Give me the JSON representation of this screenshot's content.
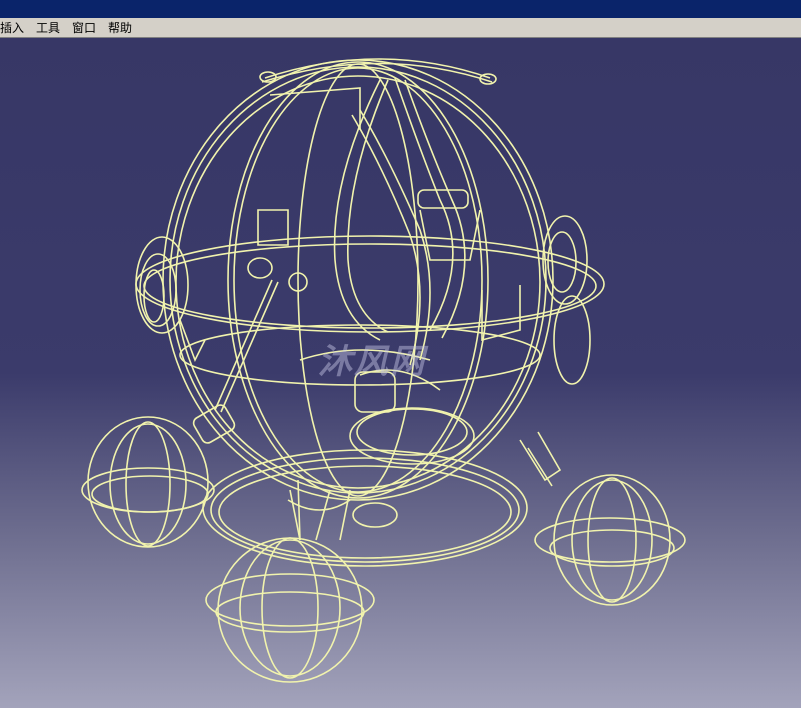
{
  "window": {
    "title_bar_color": "#0a246a"
  },
  "menu": {
    "items": [
      {
        "label": "插入"
      },
      {
        "label": "工具"
      },
      {
        "label": "窗口"
      },
      {
        "label": "帮助"
      }
    ]
  },
  "viewport": {
    "background_top": "#373766",
    "background_bottom": "#a3a3bb",
    "wire_color": "#f1f3ad",
    "watermark_text": "沐风网"
  }
}
